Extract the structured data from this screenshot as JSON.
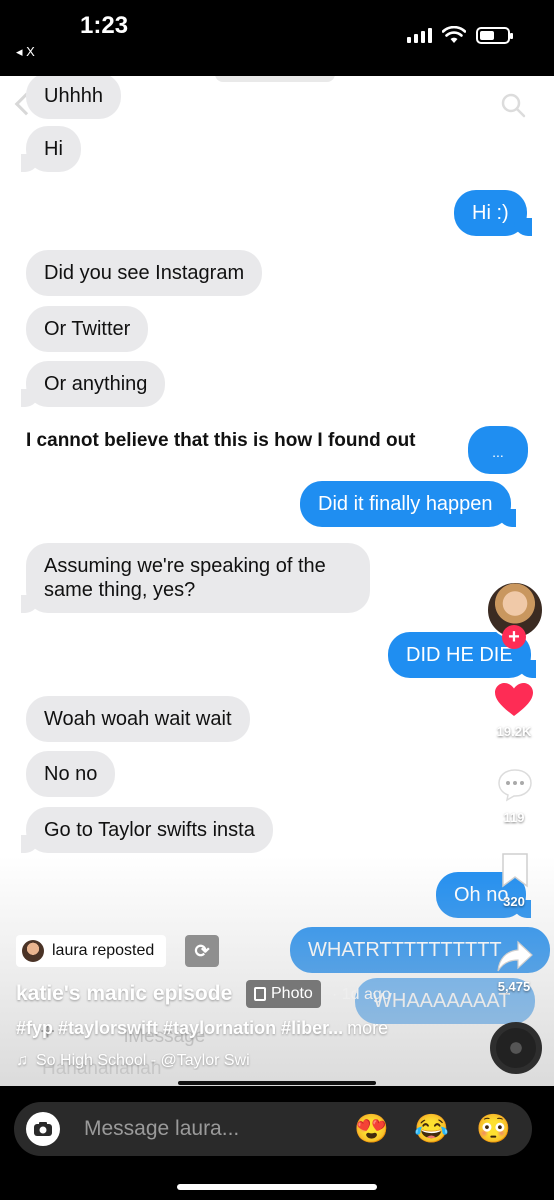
{
  "status_bar": {
    "time": "1:23",
    "back_label": "◂ X"
  },
  "messages": [
    {
      "text": "Uhhhh",
      "side": "in"
    },
    {
      "text": "Hi",
      "side": "in"
    },
    {
      "text": "Hi :)",
      "side": "out"
    },
    {
      "text": "Did you see Instagram",
      "side": "in"
    },
    {
      "text": "Or Twitter",
      "side": "in"
    },
    {
      "text": "Or anything",
      "side": "in"
    },
    {
      "text": "...",
      "side": "out"
    },
    {
      "text": "Did it finally happen",
      "side": "out"
    },
    {
      "text": "Assuming we're speaking of the same thing, yes?",
      "side": "in"
    },
    {
      "text": "DID HE DIE",
      "side": "out"
    },
    {
      "text": "Woah woah wait wait",
      "side": "in"
    },
    {
      "text": "No no",
      "side": "in"
    },
    {
      "text": "Go to Taylor swifts insta",
      "side": "in"
    },
    {
      "text": "Oh no",
      "side": "out"
    },
    {
      "text": "WHATRTTTTTTTTTT",
      "side": "out"
    },
    {
      "text": "WHAAAAAAAT",
      "side": "out"
    }
  ],
  "overlay_caption": "I cannot believe that this is how I found out",
  "faded_input": {
    "imessage_placeholder": "iMessage",
    "draft": "Hahahahahah"
  },
  "actions": {
    "likes": "19.2K",
    "comments": "119",
    "saves": "320",
    "shares": "5,475"
  },
  "colors": {
    "like": "#fe2c55",
    "imessage_blue": "#1f8ef1",
    "bubble_gray": "#e9e9eb"
  },
  "post": {
    "repost_label": "laura reposted",
    "title": "katie's manic episode",
    "badge": "Photo",
    "age": "· 1d ago",
    "hashtags": "#fyp #taylorswift #taylornation #liber...",
    "more": "more",
    "sound": "So High School - @Taylor Swi"
  },
  "bottom": {
    "message_placeholder": "Message laura...",
    "emojis": [
      "😍",
      "😂",
      "😳"
    ]
  }
}
